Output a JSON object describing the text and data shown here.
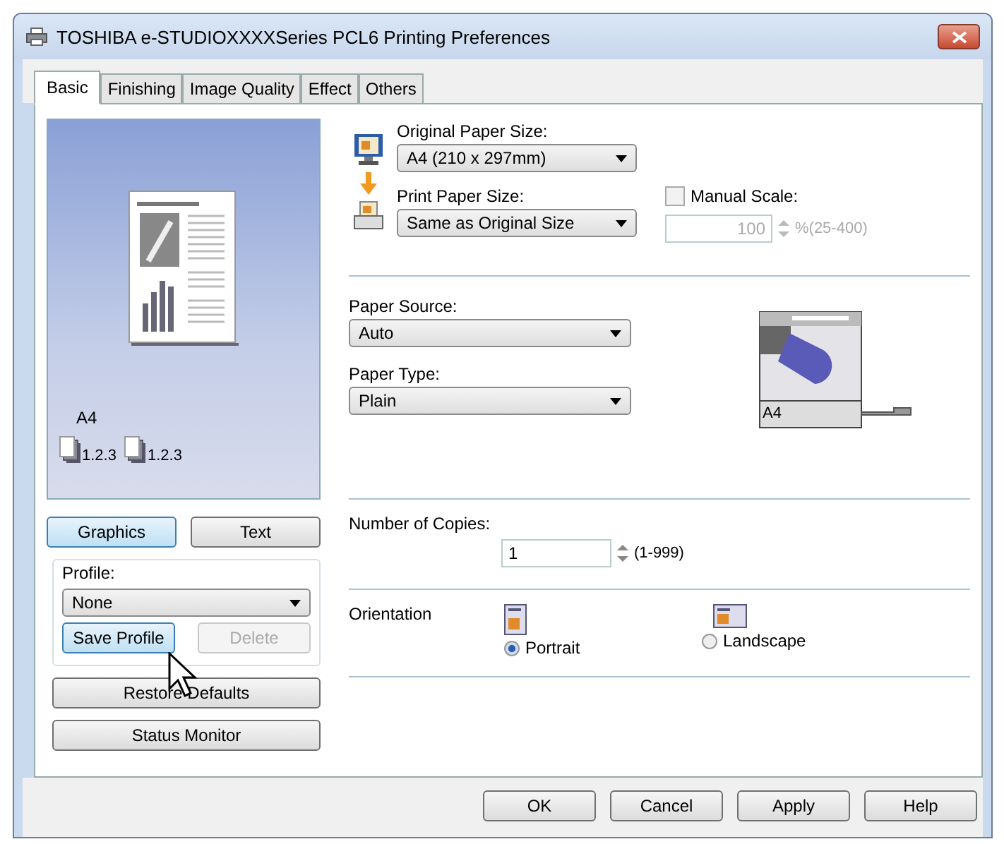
{
  "window": {
    "title": "TOSHIBA e-STUDIOXXXXSeries PCL6 Printing Preferences"
  },
  "tabs": [
    {
      "label": "Basic",
      "selected": true
    },
    {
      "label": "Finishing",
      "selected": false
    },
    {
      "label": "Image Quality",
      "selected": false
    },
    {
      "label": "Effect",
      "selected": false
    },
    {
      "label": "Others",
      "selected": false
    }
  ],
  "preview": {
    "paper_size": "A4",
    "stack_labels": [
      "1.2.3",
      "1.2.3"
    ]
  },
  "view_buttons": [
    {
      "label": "Graphics",
      "selected": true
    },
    {
      "label": "Text",
      "selected": false
    }
  ],
  "profile": {
    "label": "Profile:",
    "value": "None",
    "buttons": [
      {
        "label": "Save Profile",
        "disabled": false
      },
      {
        "label": "Delete",
        "disabled": true
      }
    ]
  },
  "side_buttons": [
    "Restore Defaults",
    "Status Monitor"
  ],
  "original_size": {
    "label": "Original Paper Size:",
    "value": "A4 (210 x 297mm)"
  },
  "print_size": {
    "label": "Print Paper Size:",
    "value": "Same as Original Size"
  },
  "manual_scale": {
    "label": "Manual Scale:",
    "checked": false,
    "disabled": true,
    "value": "100",
    "range": "%(25-400)"
  },
  "paper_source": {
    "label": "Paper Source:",
    "value": "Auto"
  },
  "paper_type": {
    "label": "Paper Type:",
    "value": "Plain"
  },
  "tray_label": "A4",
  "copies": {
    "label": "Number of Copies:",
    "value": "1",
    "range": "(1-999)"
  },
  "orientation": {
    "label": "Orientation",
    "options": [
      {
        "label": "Portrait",
        "selected": true
      },
      {
        "label": "Landscape",
        "selected": false
      }
    ]
  },
  "buttons": [
    "OK",
    "Cancel",
    "Apply",
    "Help"
  ]
}
